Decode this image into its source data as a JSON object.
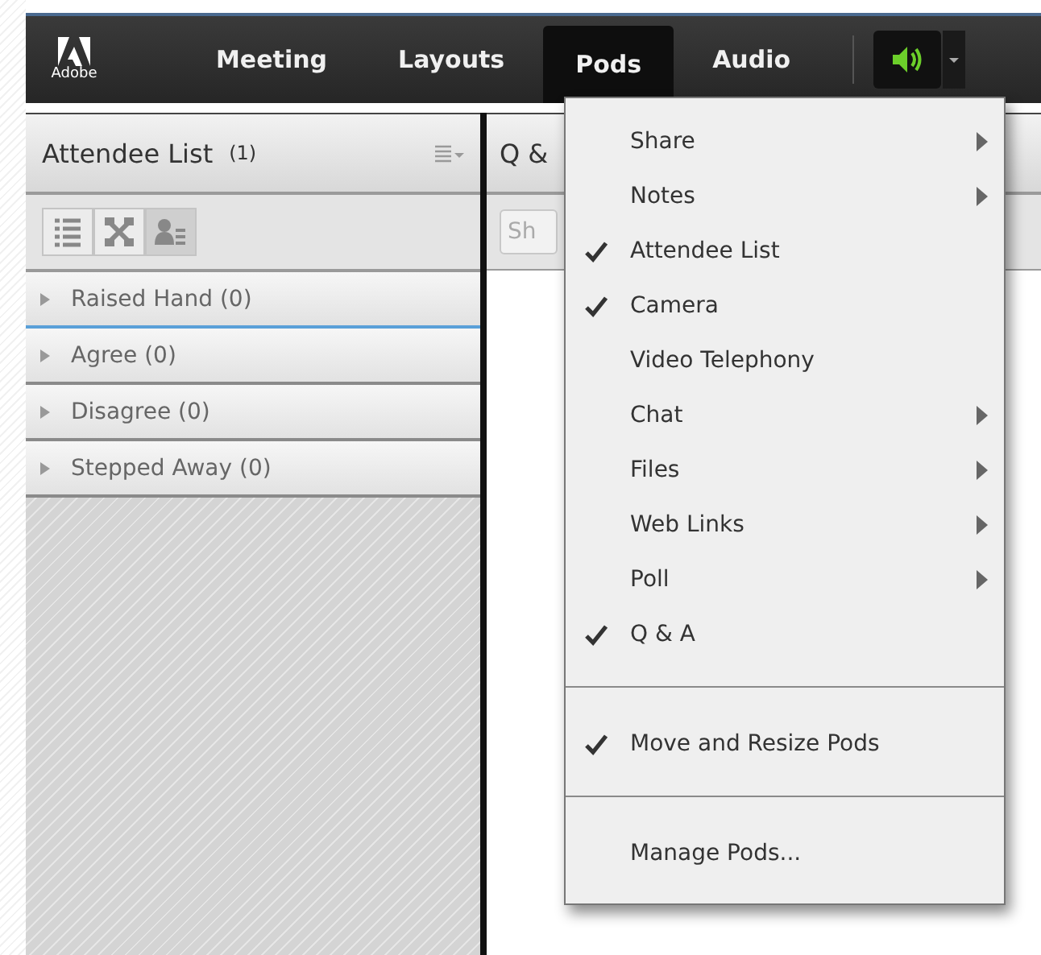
{
  "menu_bar": {
    "logo": "Adobe",
    "items": [
      {
        "label": "Meeting",
        "selected": false
      },
      {
        "label": "Layouts",
        "selected": false
      },
      {
        "label": "Pods",
        "selected": true
      },
      {
        "label": "Audio",
        "selected": false
      }
    ],
    "speaker_on": true
  },
  "attendee_pod": {
    "title": "Attendee List",
    "count": "(1)",
    "view_buttons": [
      {
        "kind": "list",
        "selected": false
      },
      {
        "kind": "grid",
        "selected": false
      },
      {
        "kind": "person",
        "selected": true
      }
    ],
    "groups": [
      {
        "label": "Raised Hand (0)",
        "expanded": false,
        "selected": true
      },
      {
        "label": "Agree (0)",
        "expanded": false,
        "selected": false
      },
      {
        "label": "Disagree (0)",
        "expanded": false,
        "selected": false
      },
      {
        "label": "Stepped Away (0)",
        "expanded": false,
        "selected": false
      }
    ]
  },
  "qa_pod": {
    "title": "Q &",
    "field_value": "Sh"
  },
  "pods_menu": {
    "items": [
      {
        "kind": "item",
        "label": "Share",
        "checked": false,
        "submenu": true
      },
      {
        "kind": "item",
        "label": "Notes",
        "checked": false,
        "submenu": true
      },
      {
        "kind": "item",
        "label": "Attendee List",
        "checked": true,
        "submenu": false
      },
      {
        "kind": "item",
        "label": "Camera",
        "checked": true,
        "submenu": false
      },
      {
        "kind": "item",
        "label": "Video Telephony",
        "checked": false,
        "submenu": false
      },
      {
        "kind": "item",
        "label": "Chat",
        "checked": false,
        "submenu": true
      },
      {
        "kind": "item",
        "label": "Files",
        "checked": false,
        "submenu": true
      },
      {
        "kind": "item",
        "label": "Web Links",
        "checked": false,
        "submenu": true
      },
      {
        "kind": "item",
        "label": "Poll",
        "checked": false,
        "submenu": true
      },
      {
        "kind": "item",
        "label": "Q & A",
        "checked": true,
        "submenu": false
      },
      {
        "kind": "separator"
      },
      {
        "kind": "item",
        "label": "Move and Resize Pods",
        "checked": true,
        "submenu": false
      },
      {
        "kind": "separator"
      },
      {
        "kind": "item",
        "label": "Manage Pods...",
        "checked": false,
        "submenu": false
      }
    ]
  }
}
